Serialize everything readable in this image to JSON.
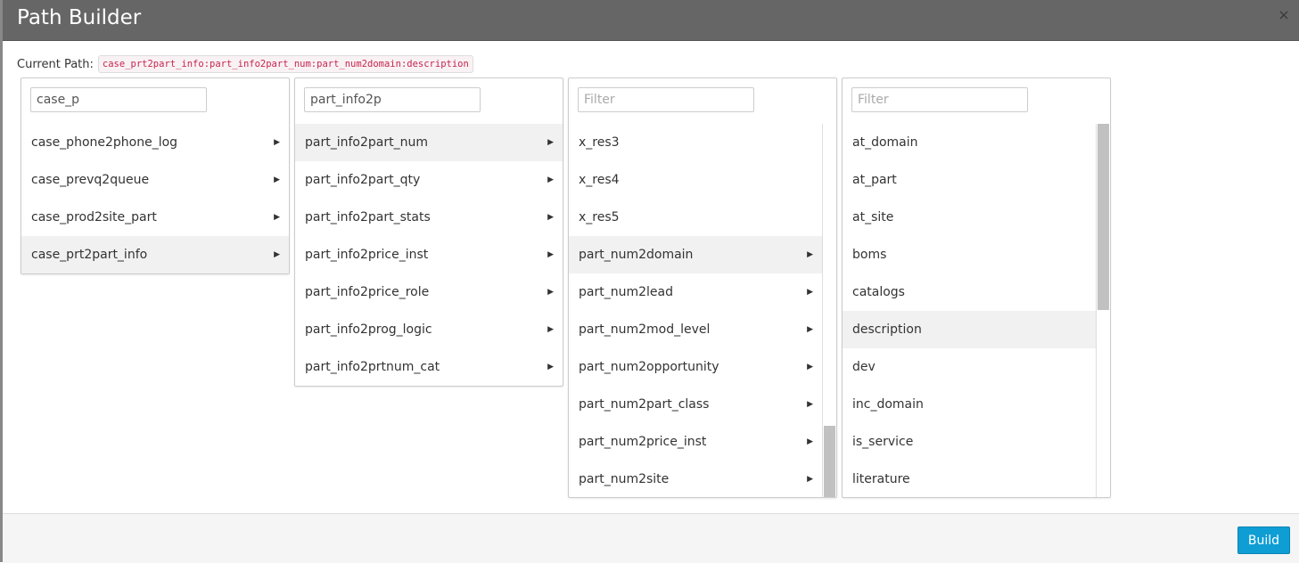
{
  "dialog": {
    "title": "Path Builder",
    "close_glyph": "×",
    "current_path_label": "Current Path:",
    "current_path_value": "case_prt2part_info:part_info2part_num:part_num2domain:description",
    "build_label": "Build"
  },
  "columns": [
    {
      "filter_value": "case_p",
      "filter_placeholder": "",
      "items": [
        {
          "label": "case_phone2phone_log",
          "has_children": true,
          "selected": false
        },
        {
          "label": "case_prevq2queue",
          "has_children": true,
          "selected": false
        },
        {
          "label": "case_prod2site_part",
          "has_children": true,
          "selected": false
        },
        {
          "label": "case_prt2part_info",
          "has_children": true,
          "selected": true
        }
      ]
    },
    {
      "filter_value": "part_info2p",
      "filter_placeholder": "",
      "items": [
        {
          "label": "part_info2part_num",
          "has_children": true,
          "selected": true
        },
        {
          "label": "part_info2part_qty",
          "has_children": true,
          "selected": false
        },
        {
          "label": "part_info2part_stats",
          "has_children": true,
          "selected": false
        },
        {
          "label": "part_info2price_inst",
          "has_children": true,
          "selected": false
        },
        {
          "label": "part_info2price_role",
          "has_children": true,
          "selected": false
        },
        {
          "label": "part_info2prog_logic",
          "has_children": true,
          "selected": false
        },
        {
          "label": "part_info2prtnum_cat",
          "has_children": true,
          "selected": false
        }
      ]
    },
    {
      "filter_value": "",
      "filter_placeholder": "Filter",
      "items": [
        {
          "label": "x_res3",
          "has_children": false,
          "selected": false
        },
        {
          "label": "x_res4",
          "has_children": false,
          "selected": false
        },
        {
          "label": "x_res5",
          "has_children": false,
          "selected": false
        },
        {
          "label": "part_num2domain",
          "has_children": true,
          "selected": true
        },
        {
          "label": "part_num2lead",
          "has_children": true,
          "selected": false
        },
        {
          "label": "part_num2mod_level",
          "has_children": true,
          "selected": false
        },
        {
          "label": "part_num2opportunity",
          "has_children": true,
          "selected": false
        },
        {
          "label": "part_num2part_class",
          "has_children": true,
          "selected": false
        },
        {
          "label": "part_num2price_inst",
          "has_children": true,
          "selected": false
        },
        {
          "label": "part_num2site",
          "has_children": true,
          "selected": false
        }
      ],
      "scroll_position": 1.0
    },
    {
      "filter_value": "",
      "filter_placeholder": "Filter",
      "items": [
        {
          "label": "at_domain",
          "has_children": false,
          "selected": false
        },
        {
          "label": "at_part",
          "has_children": false,
          "selected": false
        },
        {
          "label": "at_site",
          "has_children": false,
          "selected": false
        },
        {
          "label": "boms",
          "has_children": false,
          "selected": false
        },
        {
          "label": "catalogs",
          "has_children": false,
          "selected": false
        },
        {
          "label": "description",
          "has_children": false,
          "selected": true
        },
        {
          "label": "dev",
          "has_children": false,
          "selected": false
        },
        {
          "label": "inc_domain",
          "has_children": false,
          "selected": false
        },
        {
          "label": "is_service",
          "has_children": false,
          "selected": false
        },
        {
          "label": "literature",
          "has_children": false,
          "selected": false
        }
      ],
      "scroll_position": 0.0
    }
  ],
  "icons": {
    "submenu_arrow": "arrow-right-icon",
    "close": "close-icon"
  },
  "colors": {
    "header_bg": "#666666",
    "button_bg": "#0e9ed4",
    "path_code_color": "#c7254e",
    "selected_row_bg": "#f1f1f1"
  }
}
